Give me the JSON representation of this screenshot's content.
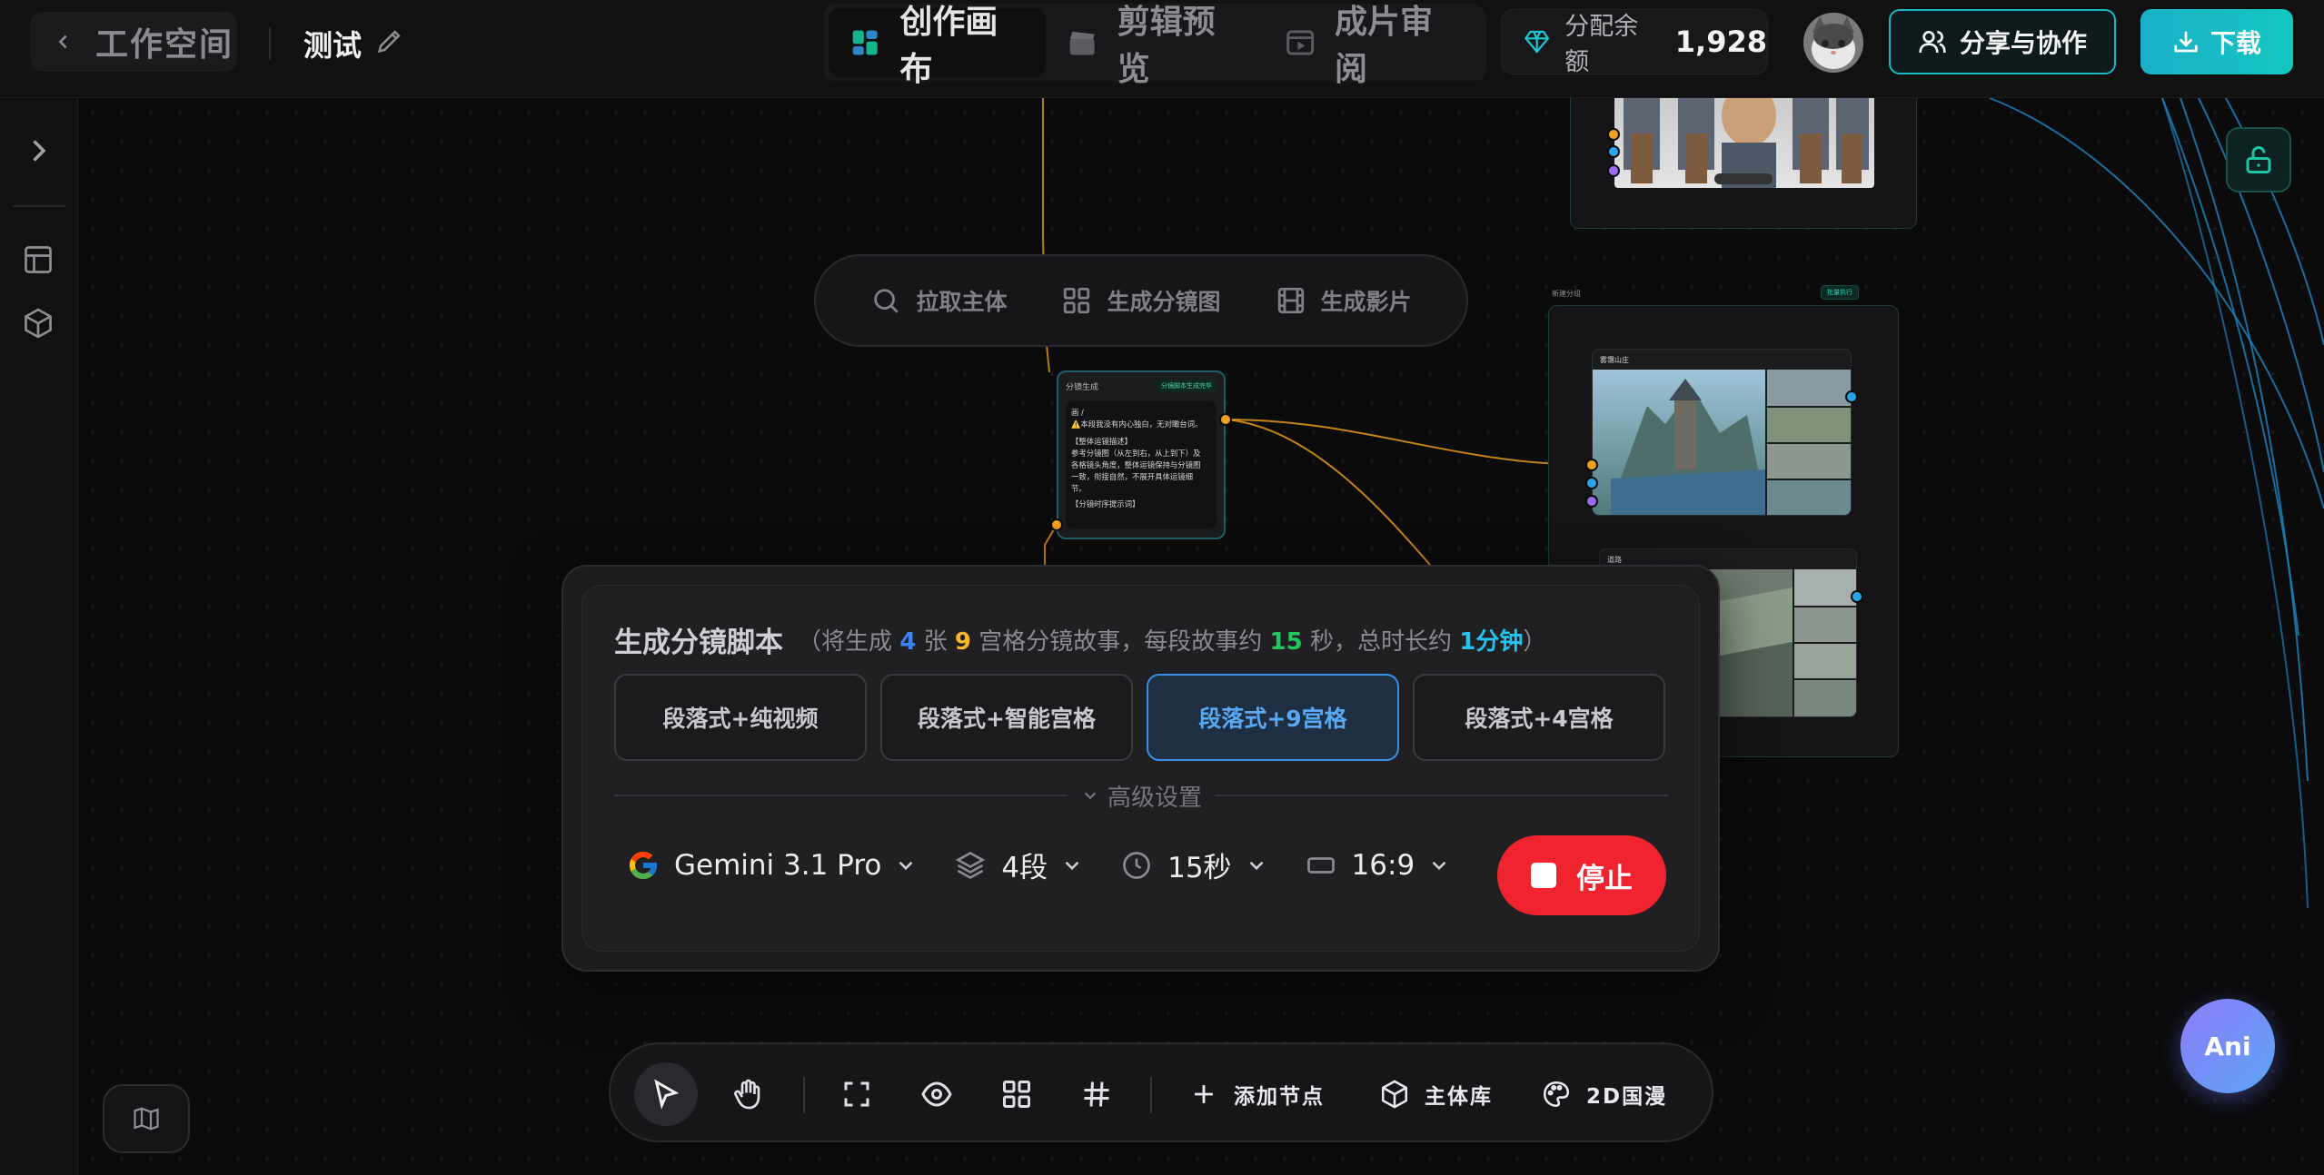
{
  "header": {
    "back_label": "工作空间",
    "project_name": "测试",
    "tabs": [
      {
        "label": "创作画布",
        "active": true
      },
      {
        "label": "剪辑预览",
        "active": false
      },
      {
        "label": "成片审阅",
        "active": false
      }
    ],
    "balance_label": "分配余额",
    "balance_value": "1,928",
    "share_label": "分享与协作",
    "download_label": "下载"
  },
  "action_pill": {
    "items": [
      "拉取主体",
      "生成分镜图",
      "生成影片"
    ]
  },
  "script_node": {
    "title": "分镜生成",
    "badge": "分镜脚本生成完毕",
    "lines": [
      "画 /",
      "⚠️本段我没有内心独白，无对瞰台词。",
      "【整体运镜描述】",
      "参考分镜图（从左到右，从上到下）及",
      "各格镜头角度，整体运镜保持与分镜图",
      "一致，衔接自然，不展开具体运镜细",
      "节。",
      "【分镜时序提示词】"
    ]
  },
  "storyboard_group": {
    "label": "新建分组",
    "tag": "批量执行",
    "card1_title": "雾霭山庄",
    "card2_title": "道路"
  },
  "gen_panel": {
    "title": "生成分镜脚本",
    "sub_prefix": "（将生成 ",
    "count": "4",
    "sub_mid1": " 张 ",
    "grid": "9",
    "sub_mid2": " 宫格分镜故事，每段故事约 ",
    "seconds": "15",
    "sub_mid3": " 秒，总时长约 ",
    "total": "1分钟",
    "sub_suffix": "）",
    "modes": [
      {
        "label": "段落式+纯视频",
        "active": false
      },
      {
        "label": "段落式+智能宫格",
        "active": false
      },
      {
        "label": "段落式+9宫格",
        "active": true
      },
      {
        "label": "段落式+4宫格",
        "active": false
      }
    ],
    "advanced_label": "高级设置",
    "model": "Gemini 3.1 Pro",
    "segments": "4段",
    "duration": "15秒",
    "ratio": "16:9",
    "stop_label": "停止"
  },
  "toolbar": {
    "add_node": "添加节点",
    "subject_lib": "主体库",
    "style": "2D国漫"
  },
  "assistant_label": "Ani",
  "colors": {
    "accent_cyan": "#18b9c5",
    "active_blue": "#3b8fe9",
    "stop_red": "#f0232e",
    "wire_orange": "#e59a1c",
    "wire_blue": "#1f7fb8"
  }
}
